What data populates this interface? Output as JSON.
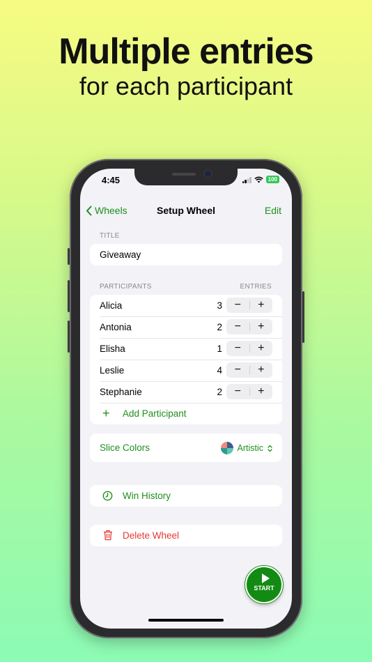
{
  "headline": {
    "line1": "Multiple entries",
    "line2": "for each participant"
  },
  "status": {
    "time": "4:45",
    "battery": "100"
  },
  "nav": {
    "back_label": "Wheels",
    "title": "Setup Wheel",
    "edit_label": "Edit"
  },
  "title_section": {
    "label": "TITLE",
    "value": "Giveaway"
  },
  "participants_section": {
    "label": "PARTICIPANTS",
    "entries_label": "ENTRIES",
    "rows": [
      {
        "name": "Alicia",
        "count": "3"
      },
      {
        "name": "Antonia",
        "count": "2"
      },
      {
        "name": "Elisha",
        "count": "1"
      },
      {
        "name": "Leslie",
        "count": "4"
      },
      {
        "name": "Stephanie",
        "count": "2"
      }
    ],
    "add_label": "Add Participant"
  },
  "slice_colors": {
    "label": "Slice Colors",
    "value": "Artistic"
  },
  "win_history": {
    "label": "Win History"
  },
  "delete_wheel": {
    "label": "Delete Wheel"
  },
  "start": {
    "label": "START"
  },
  "colors": {
    "accent": "#1e8f1e",
    "destructive": "#e53935",
    "start_button": "#138a13"
  }
}
